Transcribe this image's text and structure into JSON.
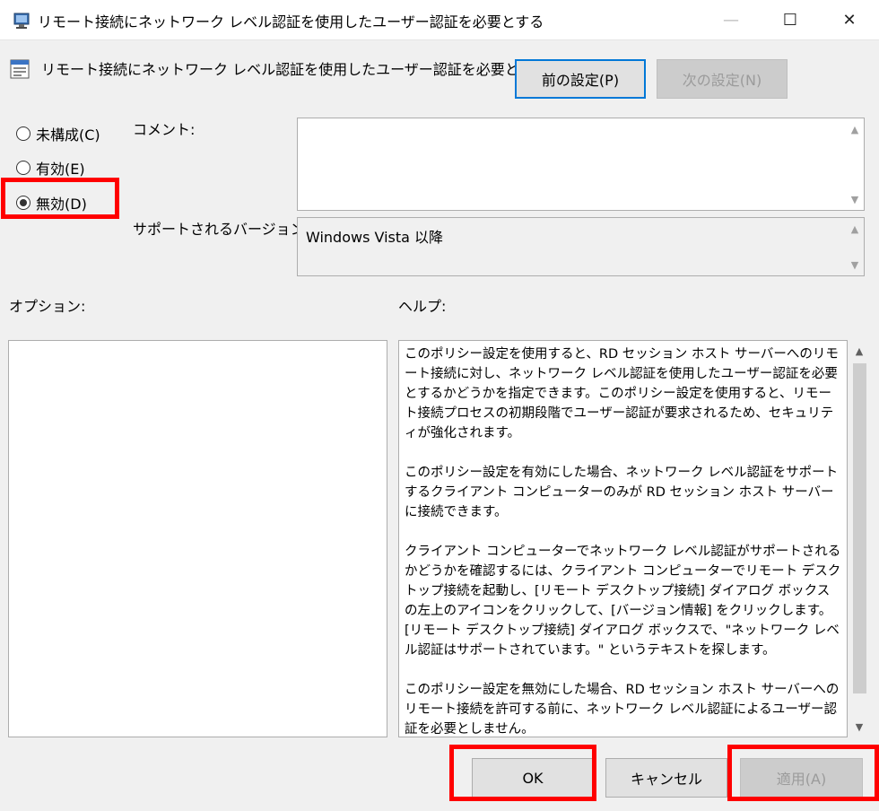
{
  "window": {
    "title": "リモート接続にネットワーク レベル認証を使用したユーザー認証を必要とする",
    "minimize": "—",
    "maximize": "☐",
    "close": "✕"
  },
  "header": {
    "title": "リモート接続にネットワーク レベル認証を使用したユーザー認証を必要とする",
    "prev_button": "前の設定(P)",
    "next_button": "次の設定(N)"
  },
  "state": {
    "options": [
      {
        "label": "未構成(C)",
        "checked": false
      },
      {
        "label": "有効(E)",
        "checked": false
      },
      {
        "label": "無効(D)",
        "checked": true
      }
    ]
  },
  "comment": {
    "label": "コメント:",
    "value": ""
  },
  "supported": {
    "label": "サポートされるバージョン:",
    "value": "Windows Vista 以降"
  },
  "options_label": "オプション:",
  "help": {
    "label": "ヘルプ:",
    "paragraphs": [
      "このポリシー設定を使用すると、RD セッション ホスト サーバーへのリモート接続に対し、ネットワーク レベル認証を使用したユーザー認証を必要とするかどうかを指定できます。このポリシー設定を使用すると、リモート接続プロセスの初期段階でユーザー認証が要求されるため、セキュリティが強化されます。",
      "このポリシー設定を有効にした場合、ネットワーク レベル認証をサポートするクライアント コンピューターのみが RD セッション ホスト サーバーに接続できます。",
      "クライアント コンピューターでネットワーク レベル認証がサポートされるかどうかを確認するには、クライアント コンピューターでリモート デスクトップ接続を起動し、[リモート デスクトップ接続] ダイアログ ボックスの左上のアイコンをクリックして、[バージョン情報] をクリックします。[リモート デスクトップ接続] ダイアログ ボックスで、\"ネットワーク レベル認証はサポートされています。\" というテキストを探します。",
      "このポリシー設定を無効にした場合、RD セッション ホスト サーバーへのリモート接続を許可する前に、ネットワーク レベル認証によるユーザー認証を必要としません。"
    ]
  },
  "footer": {
    "ok": "OK",
    "cancel": "キャンセル",
    "apply": "適用(A)"
  },
  "colors": {
    "highlight": "#ff0000",
    "default_button_border": "#0078d7"
  }
}
